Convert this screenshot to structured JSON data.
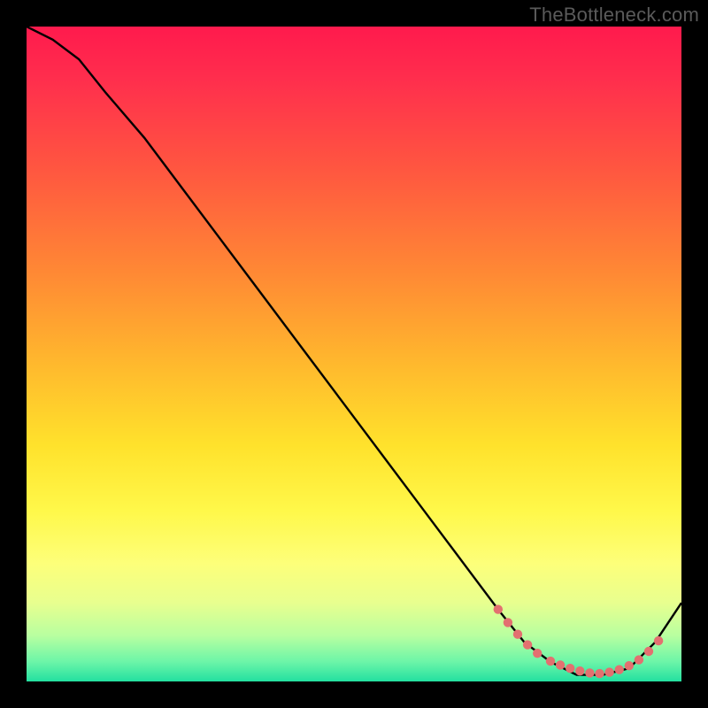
{
  "watermark": "TheBottleneck.com",
  "chart_data": {
    "type": "line",
    "title": "",
    "xlabel": "",
    "ylabel": "",
    "xlim": [
      0,
      100
    ],
    "ylim": [
      0,
      100
    ],
    "series": [
      {
        "name": "curve",
        "x": [
          0,
          4,
          8,
          12,
          18,
          24,
          30,
          36,
          42,
          48,
          54,
          60,
          66,
          72,
          76,
          80,
          84,
          88,
          92,
          96,
          100
        ],
        "y": [
          100,
          98,
          95,
          90,
          83,
          75,
          67,
          59,
          51,
          43,
          35,
          27,
          19,
          11,
          6,
          3,
          1,
          1,
          2,
          6,
          12
        ]
      }
    ],
    "highlight_points": {
      "name": "dotted-segment",
      "points": [
        {
          "x": 72.0,
          "y": 11.0
        },
        {
          "x": 73.5,
          "y": 9.0
        },
        {
          "x": 75.0,
          "y": 7.2
        },
        {
          "x": 76.5,
          "y": 5.6
        },
        {
          "x": 78.0,
          "y": 4.3
        },
        {
          "x": 80.0,
          "y": 3.1
        },
        {
          "x": 81.5,
          "y": 2.5
        },
        {
          "x": 83.0,
          "y": 2.0
        },
        {
          "x": 84.5,
          "y": 1.6
        },
        {
          "x": 86.0,
          "y": 1.3
        },
        {
          "x": 87.5,
          "y": 1.2
        },
        {
          "x": 89.0,
          "y": 1.4
        },
        {
          "x": 90.5,
          "y": 1.8
        },
        {
          "x": 92.0,
          "y": 2.4
        },
        {
          "x": 93.5,
          "y": 3.3
        },
        {
          "x": 95.0,
          "y": 4.6
        },
        {
          "x": 96.5,
          "y": 6.2
        }
      ]
    },
    "colors": {
      "curve_stroke": "#000000",
      "dot_fill": "#e37070"
    }
  }
}
